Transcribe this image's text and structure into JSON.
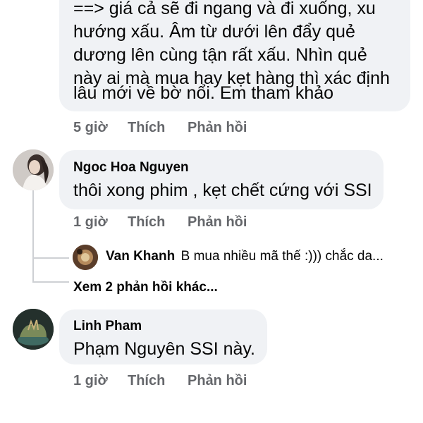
{
  "top_comment": {
    "lines": [
      "==> giá cả sẽ đi ngang và đi xuống, xu",
      "hướng xấu. Âm từ dưới lên đẩy quẻ",
      "dương lên cùng tận rất xấu.  Nhìn quẻ",
      "này ai mà mua hay kẹt hàng thì xác định",
      "lâu mới về bờ nổi. Em tham khảo"
    ],
    "time": "5 giờ",
    "like": "Thích",
    "reply": "Phản hồi"
  },
  "comment_ngoc": {
    "author": "Ngoc Hoa Nguyen",
    "text": "thôi xong phim , kẹt chết cứng với SSI",
    "time": "1 giờ",
    "like": "Thích",
    "reply": "Phản hồi"
  },
  "reply_preview": {
    "author": "Van Khanh",
    "text": "B mua nhiều mã thế :))) chắc da..."
  },
  "more_replies": "Xem 2 phản hồi khác...",
  "comment_linh": {
    "author": "Linh Pham",
    "text": "Phạm Nguyên SSI này.",
    "time": "1 giờ",
    "like": "Thích",
    "reply": "Phản hồi"
  },
  "colors": {
    "bubble": "#f0f2f5",
    "meta_text": "#65676b",
    "thread_line": "#ced0d4"
  }
}
